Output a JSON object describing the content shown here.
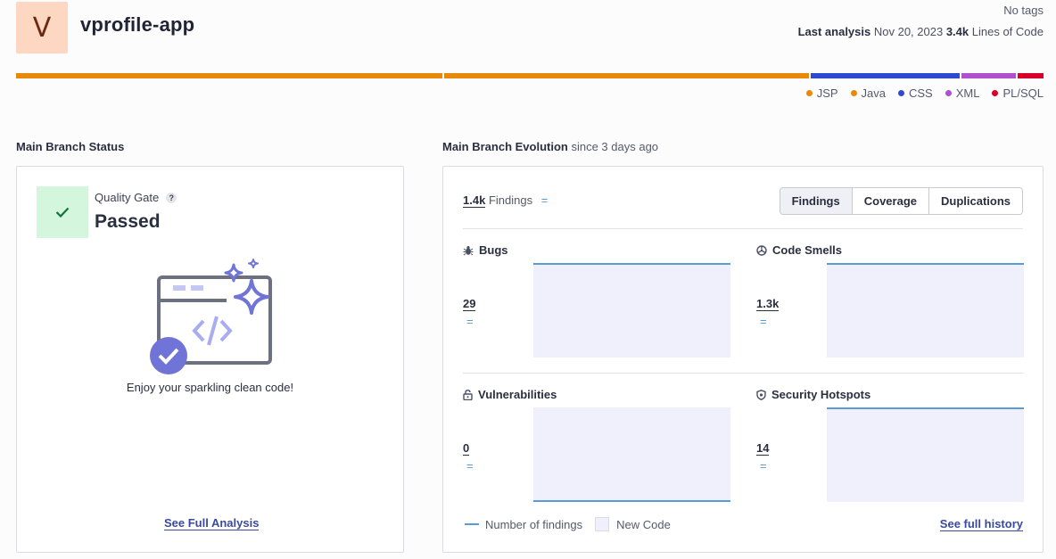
{
  "project": {
    "initial": "V",
    "name": "vprofile-app",
    "tags": "No tags",
    "last_analysis_label": "Last analysis",
    "last_analysis_date": "Nov 20, 2023",
    "lines_of_code_value": "3.4k",
    "lines_of_code_label": "Lines of Code"
  },
  "languages": [
    {
      "name": "JSP",
      "color": "#e8890c",
      "share": 0.418
    },
    {
      "name": "Java",
      "color": "#e8890c",
      "share": 0.357
    },
    {
      "name": "CSS",
      "color": "#2e4bcf",
      "share": 0.146
    },
    {
      "name": "XML",
      "color": "#b150cf",
      "share": 0.054
    },
    {
      "name": "PL/SQL",
      "color": "#d6002a",
      "share": 0.025
    }
  ],
  "legend": {
    "jsp": "JSP",
    "java": "Java",
    "css": "CSS",
    "xml": "XML",
    "plsql": "PL/SQL"
  },
  "main_branch_status": {
    "title": "Main Branch Status",
    "quality_gate_label": "Quality Gate",
    "quality_gate_status": "Passed",
    "message": "Enjoy your sparkling clean code!",
    "see_full_analysis": "See Full Analysis"
  },
  "evolution": {
    "title": "Main Branch Evolution",
    "since": "since 3 days ago",
    "findings_value": "1.4k",
    "findings_label": "Findings",
    "equal_sign": "=",
    "tabs": [
      "Findings",
      "Coverage",
      "Duplications"
    ],
    "metrics": {
      "bugs": {
        "title": "Bugs",
        "value": "29",
        "trend": "=",
        "level": "top"
      },
      "code_smells": {
        "title": "Code Smells",
        "value": "1.3k",
        "trend": "=",
        "level": "top"
      },
      "vulnerabilities": {
        "title": "Vulnerabilities",
        "value": "0",
        "trend": "=",
        "level": "bottom"
      },
      "security_hotspots": {
        "title": "Security Hotspots",
        "value": "14",
        "trend": "=",
        "level": "top"
      }
    },
    "legend_findings": "Number of findings",
    "legend_new_code": "New Code",
    "see_full_history": "See full history"
  },
  "colors": {
    "accent_line": "#5b9bd5",
    "new_code_area": "#eff0fb",
    "quality_gate_passed": "#d3f6dc",
    "avatar_bg": "#fdd7c2"
  }
}
